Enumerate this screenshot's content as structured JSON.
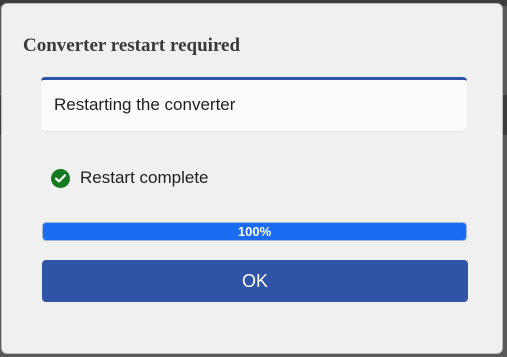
{
  "dialog": {
    "title": "Converter restart required",
    "status_text": "Restarting the converter",
    "complete_text": "Restart complete",
    "progress": {
      "value": 1.0,
      "label": "100%"
    },
    "ok_label": "OK"
  },
  "colors": {
    "accent": "#2f53a7",
    "progress_fill": "#1b6cf2",
    "success": "#157a1f"
  },
  "icons": {
    "complete": "check-circle-icon"
  }
}
